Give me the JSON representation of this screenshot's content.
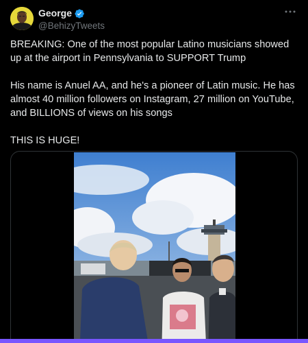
{
  "author": {
    "name": "George",
    "handle": "@BehizyTweets"
  },
  "tweet": {
    "paragraphs": [
      "BREAKING: One of the most popular Latino musicians showed up at the airport in Pennsylvania to SUPPORT Trump",
      "His name is Anuel AA, and he's a pioneer of Latin music. He has almost 40 million followers on Instagram, 27 million on YouTube, and BILLIONS of views on his songs",
      "THIS IS HUGE!"
    ]
  },
  "icons": {
    "verified": "verified-badge-icon",
    "more": "more-options-icon"
  },
  "colors": {
    "background": "#000000",
    "text": "#e7e9ea",
    "secondary_text": "#71767b",
    "verified_blue": "#1d9bf0",
    "card_border": "#2f3336",
    "accent_bar": "#7856ff"
  }
}
